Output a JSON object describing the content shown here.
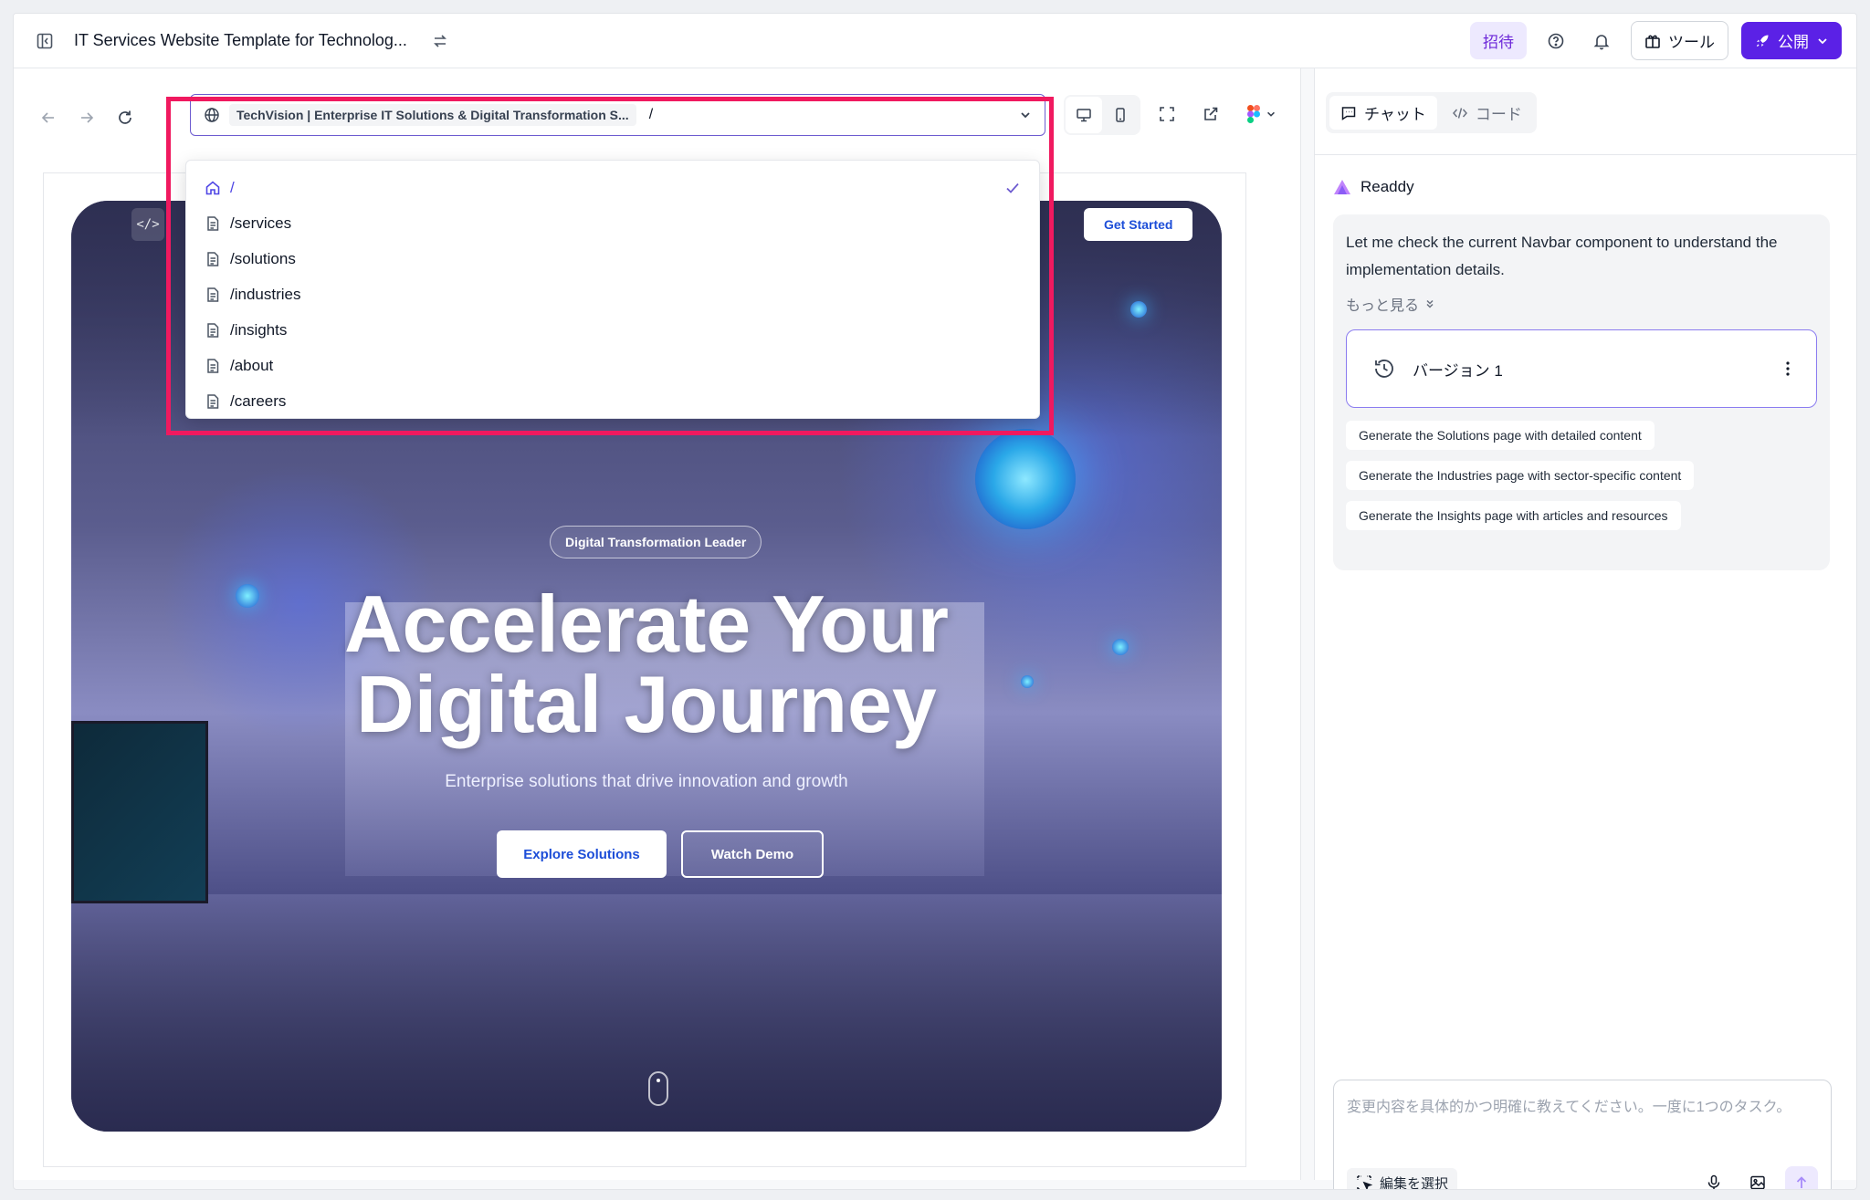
{
  "header": {
    "project_title": "IT Services Website Template for Technolog...",
    "invite_label": "招待",
    "tools_label": "ツール",
    "publish_label": "公開"
  },
  "preview": {
    "site_title": "TechVision | Enterprise IT Solutions & Digital Transformation S...",
    "current_path": "/",
    "routes": [
      {
        "path": "/",
        "icon": "home-icon",
        "selected": true
      },
      {
        "path": "/services",
        "icon": "document-icon",
        "selected": false
      },
      {
        "path": "/solutions",
        "icon": "document-icon",
        "selected": false
      },
      {
        "path": "/industries",
        "icon": "document-icon",
        "selected": false
      },
      {
        "path": "/insights",
        "icon": "document-icon",
        "selected": false
      },
      {
        "path": "/about",
        "icon": "document-icon",
        "selected": false
      },
      {
        "path": "/careers",
        "icon": "document-icon",
        "selected": false
      }
    ]
  },
  "hero": {
    "code_toggle": "</>",
    "get_started": "Get Started",
    "badge": "Digital Transformation Leader",
    "heading_line1": "Accelerate Your",
    "heading_line2": "Digital Journey",
    "subheading": "Enterprise solutions that drive innovation and growth",
    "primary_cta": "Explore Solutions",
    "secondary_cta": "Watch Demo"
  },
  "chat": {
    "tab_chat": "チャット",
    "tab_code": "コード",
    "assistant_name": "Readdy",
    "message": "Let me check the current Navbar component to understand the implementation details.",
    "more": "もっと見る",
    "version_label": "バージョン 1",
    "suggestions": [
      "Generate the Solutions page with detailed content",
      "Generate the Industries page with sector-specific content",
      "Generate the Insights page with articles and resources"
    ],
    "composer_placeholder": "変更内容を具体的かつ明確に教えてください。一度に1つのタスク。",
    "select_edit_label": "編集を選択"
  },
  "colors": {
    "accent": "#5b21e6",
    "highlight_border": "#f0195f",
    "link_blue": "#1d4ed8"
  }
}
